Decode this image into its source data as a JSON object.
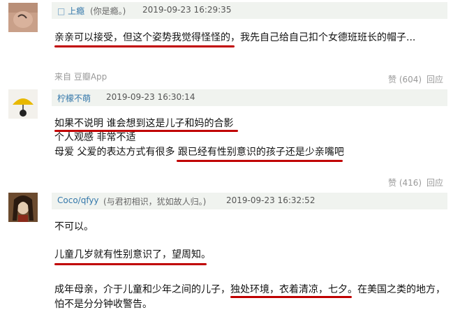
{
  "comments": [
    {
      "user": "上瘾",
      "user_prefix": "□",
      "signature": "(你是瘾。)",
      "time": "2019-09-23 16:29:35",
      "lines": [
        "亲亲可以接受，但这个姿势我觉得怪怪的，我先自己给自己扣个女德班班长的帽子..."
      ],
      "source": "来自 豆瓣App",
      "likes": "赞 (604)",
      "reply": "回应"
    },
    {
      "user": "柠檬不萌",
      "time": "2019-09-23 16:30:14",
      "lines": [
        "如果不说明 谁会想到这是儿子和妈的合影",
        "个人观感 非常不适",
        "母爱 父爱的表达方式有很多 跟已经有性别意识的孩子还是少亲嘴吧"
      ],
      "likes": "赞 (416)",
      "reply": "回应"
    },
    {
      "user": "Coco/qfyy",
      "signature": "(与君初相识，犹如故人归。)",
      "time": "2019-09-23 16:32:52",
      "lines": [
        "不可以。",
        "儿童几岁就有性别意识了，望周知。",
        "成年母亲，介于儿童和少年之间的儿子，独处环境，衣着清凉，七夕。在美国之类的地方，",
        "怕不是分分钟收警告。"
      ]
    }
  ],
  "colors": {
    "username": "#3377aa",
    "meta_bg": "#f0f3ef",
    "underline": "#c00000",
    "muted": "#999999"
  }
}
